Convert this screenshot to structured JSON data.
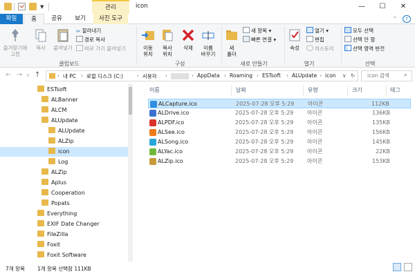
{
  "titlebar": {
    "manage_tab": "관리",
    "title": "icon",
    "minimize": "—",
    "maximize": "☐",
    "close": "✕"
  },
  "tabs": {
    "file": "파일",
    "home": "홈",
    "share": "공유",
    "view": "보기",
    "photo_tools": "사진 도구"
  },
  "ribbon": {
    "clipboard": {
      "pin": "즐겨찾기에\n고정",
      "copy": "복사",
      "paste": "붙여넣기",
      "cut": "잘라내기",
      "copy_path": "경로 복사",
      "paste_shortcut": "바로 가기 붙여넣기",
      "group": "클립보드"
    },
    "organize": {
      "move_to": "이동\n위치",
      "copy_to": "복사\n위치",
      "delete": "삭제",
      "rename": "이름\n바꾸기",
      "group": "구성"
    },
    "new": {
      "new_folder": "새\n폴더",
      "new_item": "새 항목",
      "easy_access": "빠른 연결",
      "group": "새로 만들기"
    },
    "open": {
      "properties": "속성",
      "open": "열기",
      "edit": "편집",
      "history": "히스토리",
      "group": "열기"
    },
    "select": {
      "select_all": "모두 선택",
      "select_none": "선택 안 함",
      "invert": "선택 영역 반전",
      "group": "선택"
    }
  },
  "address": {
    "crumbs": [
      "내 PC",
      "로컬 디스크 (C:)",
      "사용자",
      "",
      "AppData",
      "Roaming",
      "ESTsoft",
      "ALUpdate",
      "icon"
    ],
    "search_placeholder": "icon 검색"
  },
  "tree": [
    {
      "label": "ESTsoft",
      "level": 0,
      "selected": false
    },
    {
      "label": "ALBanner",
      "level": 1,
      "selected": false
    },
    {
      "label": "ALCM",
      "level": 1,
      "selected": false
    },
    {
      "label": "ALUpdate",
      "level": 1,
      "selected": false
    },
    {
      "label": "ALUpdate",
      "level": 2,
      "selected": false
    },
    {
      "label": "ALZip",
      "level": 2,
      "selected": false
    },
    {
      "label": "icon",
      "level": 2,
      "selected": true
    },
    {
      "label": "Log",
      "level": 2,
      "selected": false
    },
    {
      "label": "ALZip",
      "level": 1,
      "selected": false
    },
    {
      "label": "Aplus",
      "level": 1,
      "selected": false
    },
    {
      "label": "Cooperation",
      "level": 1,
      "selected": false
    },
    {
      "label": "Popats",
      "level": 1,
      "selected": false
    },
    {
      "label": "Everything",
      "level": 0,
      "selected": false
    },
    {
      "label": "EXIF Date Changer",
      "level": 0,
      "selected": false
    },
    {
      "label": "FileZilla",
      "level": 0,
      "selected": false
    },
    {
      "label": "Foxit",
      "level": 0,
      "selected": false
    },
    {
      "label": "Foxit Software",
      "level": 0,
      "selected": false
    }
  ],
  "columns": {
    "name": "이름",
    "date": "날짜",
    "type": "유형",
    "size": "크기",
    "tags": "태그"
  },
  "files": [
    {
      "name": "ALCapture.ico",
      "date": "2025-07-28 오후 5:29",
      "type": "아이콘",
      "size": "112KB",
      "selected": true,
      "icon": "alcapture-icon",
      "color": "#2f8fe0"
    },
    {
      "name": "ALDrive.ico",
      "date": "2025-07-28 오후 5:29",
      "type": "아이콘",
      "size": "136KB",
      "selected": false,
      "icon": "aldrive-icon",
      "color": "#3b6fd1"
    },
    {
      "name": "ALPDF.ico",
      "date": "2025-07-28 오후 5:29",
      "type": "아이콘",
      "size": "135KB",
      "selected": false,
      "icon": "alpdf-icon",
      "color": "#d9342b"
    },
    {
      "name": "ALSee.ico",
      "date": "2025-07-28 오후 5:29",
      "type": "아이콘",
      "size": "156KB",
      "selected": false,
      "icon": "alsee-icon",
      "color": "#ef7a1a"
    },
    {
      "name": "ALSong.ico",
      "date": "2025-07-28 오후 5:29",
      "type": "아이콘",
      "size": "145KB",
      "selected": false,
      "icon": "alsong-icon",
      "color": "#2aa6d8"
    },
    {
      "name": "ALYac.ico",
      "date": "2025-07-28 오후 5:29",
      "type": "아이콘",
      "size": "22KB",
      "selected": false,
      "icon": "alyac-icon",
      "color": "#6fb83a"
    },
    {
      "name": "ALZip.ico",
      "date": "2025-07-28 오후 5:29",
      "type": "아이콘",
      "size": "153KB",
      "selected": false,
      "icon": "alzip-icon",
      "color": "#c79a3a"
    }
  ],
  "status": {
    "count": "7개 항목",
    "selected": "1개 항목 선택함 111KB"
  }
}
